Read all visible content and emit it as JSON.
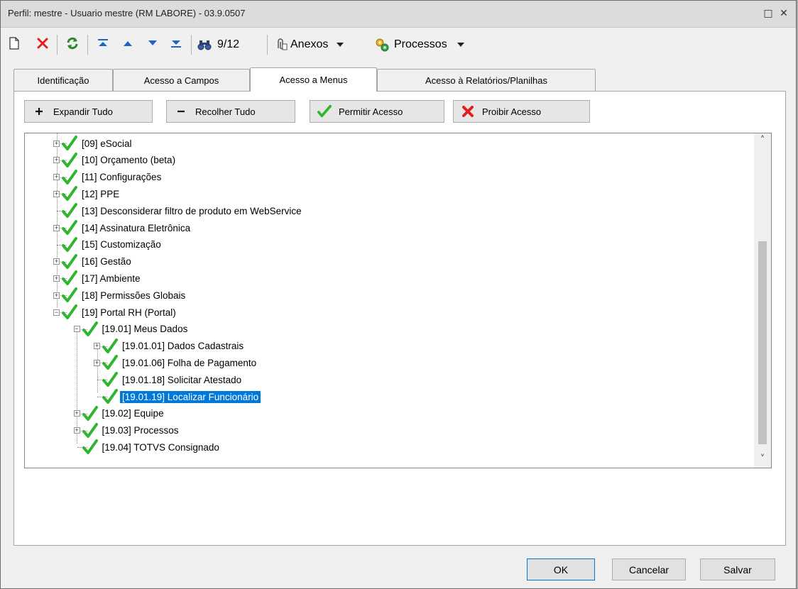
{
  "window": {
    "title": "Perfil: mestre - Usuario mestre (RM LABORE) - 03.9.0507",
    "restore_label": "□",
    "close_label": "✕"
  },
  "toolbar": {
    "record_counter": "9/12",
    "attachments_label": "Anexos",
    "processes_label": "Processos"
  },
  "tabs": [
    {
      "label": "Identificação"
    },
    {
      "label": "Acesso a Campos"
    },
    {
      "label": "Acesso a Menus"
    },
    {
      "label": "Acesso à Relatórios/Planilhas"
    }
  ],
  "actions": {
    "expand_all": "Expandir Tudo",
    "collapse_all": "Recolher Tudo",
    "allow_access": "Permitir Acesso",
    "deny_access": "Proibir Acesso"
  },
  "tree": {
    "items": [
      {
        "label": "[09] eSocial",
        "expand": "+"
      },
      {
        "label": "[10] Orçamento (beta)",
        "expand": "+"
      },
      {
        "label": "[11] Configurações",
        "expand": "+"
      },
      {
        "label": "[12] PPE",
        "expand": "+"
      },
      {
        "label": "[13] Desconsiderar filtro de produto em WebService",
        "expand": ""
      },
      {
        "label": "[14] Assinatura Eletrônica",
        "expand": "+"
      },
      {
        "label": "[15] Customização",
        "expand": ""
      },
      {
        "label": "[16] Gestão",
        "expand": "+"
      },
      {
        "label": "[17] Ambiente",
        "expand": "+"
      },
      {
        "label": "[18] Permissões Globais",
        "expand": "+"
      },
      {
        "label": "[19] Portal RH (Portal)",
        "expand": "−"
      },
      {
        "label": "[19.01] Meus Dados",
        "expand": "−"
      },
      {
        "label": "[19.01.01] Dados Cadastrais",
        "expand": "+"
      },
      {
        "label": "[19.01.06] Folha de Pagamento",
        "expand": "+"
      },
      {
        "label": "[19.01.18] Solicitar Atestado",
        "expand": ""
      },
      {
        "label": "[19.01.19] Localizar Funcionário",
        "expand": "",
        "selected": true
      },
      {
        "label": "[19.02] Equipe",
        "expand": "+"
      },
      {
        "label": "[19.03] Processos",
        "expand": "+"
      },
      {
        "label": "[19.04] TOTVS Consignado",
        "expand": ""
      }
    ],
    "scroll_up": "˄",
    "scroll_down": "˅"
  },
  "footer": {
    "ok": "OK",
    "cancel": "Cancelar",
    "save": "Salvar"
  },
  "icons": {
    "new": "new-document-icon",
    "delete": "delete-icon",
    "refresh": "refresh-icon",
    "first": "first-record-icon",
    "previous": "previous-record-icon",
    "next": "next-record-icon",
    "last": "last-record-icon",
    "find": "binoculars-icon",
    "attachment": "paperclip-icon",
    "process": "gears-icon",
    "check": "green-check-icon",
    "cross": "red-x-icon"
  },
  "colors": {
    "check_green": "#2fb52f",
    "cross_red": "#e02020",
    "selection_blue": "#0078d7",
    "nav_blue": "#1e64c8"
  }
}
